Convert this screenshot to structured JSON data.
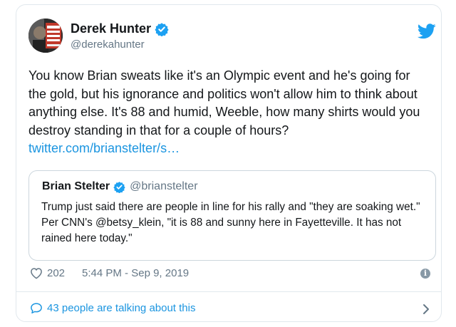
{
  "tweet": {
    "author_name": "Derek Hunter",
    "author_handle": "@derekahunter",
    "text": "You know Brian sweats like it's an Olympic event and he's going for the gold, but his ignorance and politics won't allow him to think about anything else. It's 88 and humid, Weeble, how many shirts would you destroy standing in that for a couple of hours?",
    "link": "twitter.com/brianstelter/s…",
    "likes": "202",
    "timestamp": "5:44 PM - Sep 9, 2019",
    "talking": "43 people are talking about this"
  },
  "quoted": {
    "author_name": "Brian Stelter",
    "author_handle": "@brianstelter",
    "text": "Trump just said there are people in line for his rally and \"they are soaking wet.\" Per CNN's @betsy_klein, \"it is 88 and sunny here in Fayetteville. It has not rained here today.\""
  },
  "colors": {
    "accent": "#1b95e0",
    "muted": "#657786",
    "border": "#e1e8ed"
  },
  "icons": [
    "verified-badge-icon",
    "twitter-bird-icon",
    "heart-icon",
    "info-icon",
    "speech-bubble-icon",
    "chevron-right-icon"
  ]
}
